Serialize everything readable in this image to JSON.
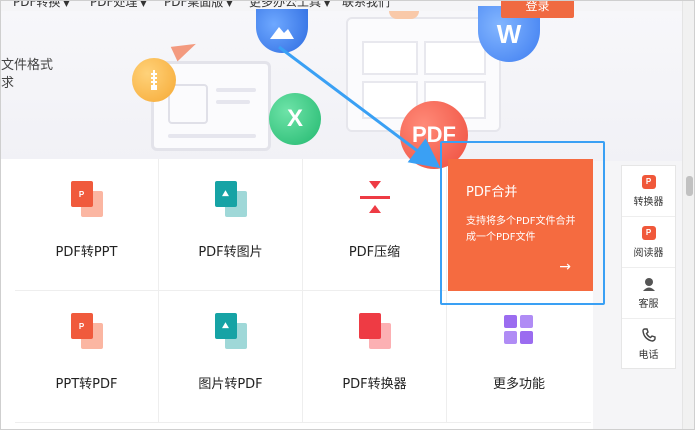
{
  "nav": {
    "items": [
      "PDF转换",
      "PDF处理",
      "PDF桌面版",
      "更多办公工具",
      "联系我们"
    ],
    "login_label": "登录"
  },
  "hero": {
    "line1": "文件格式",
    "line2": "求",
    "badges": {
      "excel": "X",
      "word": "W",
      "pdf": "PDF"
    }
  },
  "tools": [
    {
      "label": "PDF转PPT",
      "icon": "pdf-to-ppt-icon",
      "glyph": "P"
    },
    {
      "label": "PDF转图片",
      "icon": "pdf-to-image-icon",
      "glyph": "⛰"
    },
    {
      "label": "PDF压缩",
      "icon": "compress-icon",
      "glyph": ""
    },
    {
      "label": "PPT转PDF",
      "icon": "ppt-to-pdf-icon",
      "glyph": "P"
    },
    {
      "label": "图片转PDF",
      "icon": "image-to-pdf-icon",
      "glyph": "⛰"
    },
    {
      "label": "PDF转换器",
      "icon": "pdf-converter-icon",
      "glyph": ""
    },
    {
      "label": "更多功能",
      "icon": "more-features-icon",
      "glyph": ""
    }
  ],
  "featured": {
    "title": "PDF合并",
    "description": "支持将多个PDF文件合并成一个PDF文件",
    "arrow": "→"
  },
  "sidebar": {
    "items": [
      {
        "label": "转换器",
        "icon": "converter-icon",
        "glyph": "P"
      },
      {
        "label": "阅读器",
        "icon": "reader-icon",
        "glyph": "P"
      },
      {
        "label": "客服",
        "icon": "customer-service-icon",
        "glyph": "👤"
      },
      {
        "label": "电话",
        "icon": "phone-icon",
        "glyph": "✆"
      }
    ]
  },
  "colors": {
    "accent": "#f56b40",
    "highlight_border": "#3aa0f4"
  }
}
